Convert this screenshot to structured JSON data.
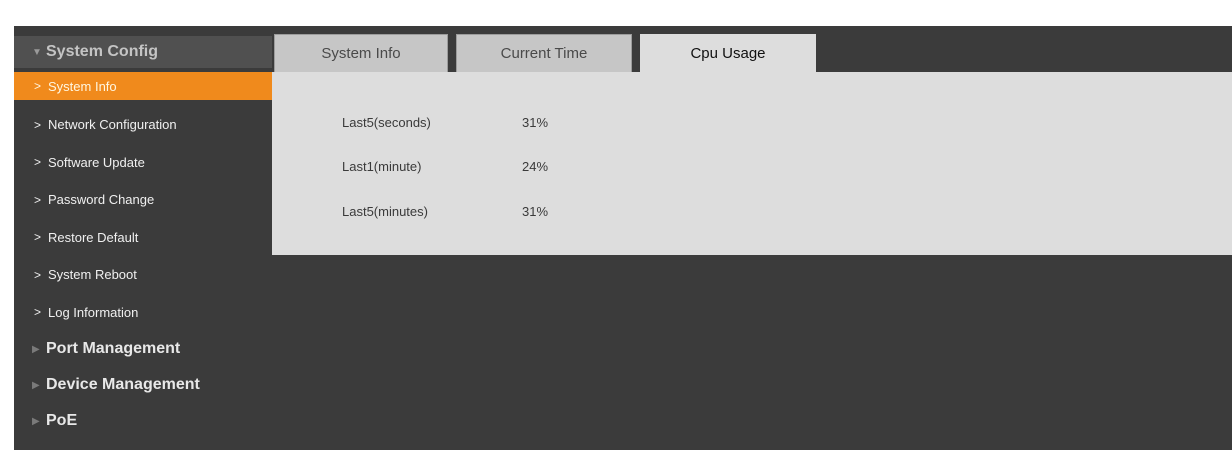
{
  "sidebar": {
    "groups": [
      {
        "label": "System Config",
        "expanded": true,
        "items": [
          {
            "label": "System Info",
            "active": true
          },
          {
            "label": "Network Configuration"
          },
          {
            "label": "Software Update"
          },
          {
            "label": "Password Change"
          },
          {
            "label": "Restore Default"
          },
          {
            "label": "System Reboot"
          },
          {
            "label": "Log Information"
          }
        ]
      },
      {
        "label": "Port Management",
        "expanded": false
      },
      {
        "label": "Device Management",
        "expanded": false
      },
      {
        "label": "PoE",
        "expanded": false
      }
    ],
    "chevron_glyph": ">",
    "expanded_glyph": "▼",
    "collapsed_glyph": "▶"
  },
  "tabs": [
    {
      "label": "System Info"
    },
    {
      "label": "Current Time"
    },
    {
      "label": "Cpu Usage",
      "active": true
    }
  ],
  "cpu_usage": {
    "rows": [
      {
        "label": "Last5(seconds)",
        "value": "31%"
      },
      {
        "label": "Last1(minute)",
        "value": "24%"
      },
      {
        "label": "Last5(minutes)",
        "value": "31%"
      }
    ]
  },
  "colors": {
    "background": "#3b3b3b",
    "active_item": "#f08a1c",
    "content_panel": "#dddddd",
    "tab_inactive": "#c6c6c6"
  }
}
